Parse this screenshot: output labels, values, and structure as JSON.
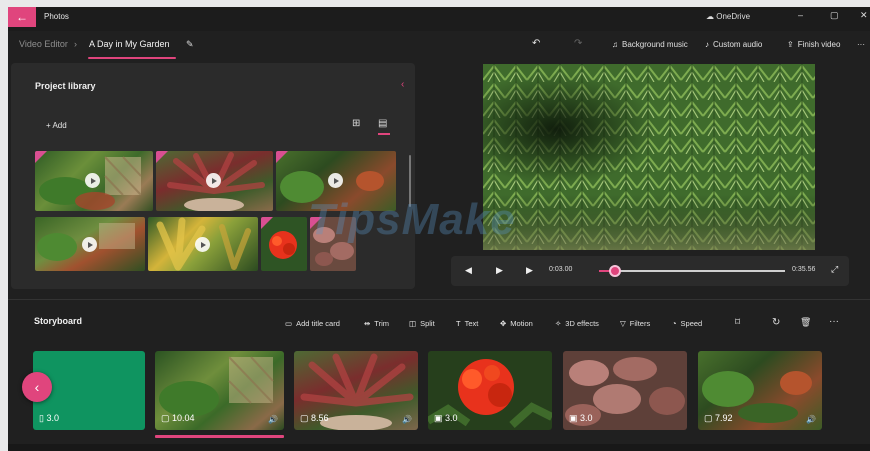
{
  "app": {
    "title": "Photos",
    "onedrive": "OneDrive",
    "back_icon": "arrow-left-icon"
  },
  "window": {
    "minimize": "–",
    "maximize": "▢",
    "close": "✕"
  },
  "nav": {
    "section": "Video Editor",
    "separator": "›",
    "project_title": "A Day in My Garden",
    "edit_icon": "pencil-icon"
  },
  "toolbar": {
    "undo": "↶",
    "redo": "↷",
    "background_music": "Background music",
    "custom_audio": "Custom audio",
    "finish_video": "Finish video",
    "more": "···"
  },
  "library": {
    "title": "Project library",
    "add_label": "+ Add",
    "grid_view_glyph": "⊞",
    "list_view_glyph": "▤",
    "collapse_glyph": "‹",
    "items": [
      {
        "type": "video",
        "palette": "garden"
      },
      {
        "type": "video",
        "palette": "leaves"
      },
      {
        "type": "video",
        "palette": "pots"
      },
      {
        "type": "video",
        "palette": "garden"
      },
      {
        "type": "video",
        "palette": "croton"
      },
      {
        "type": "image",
        "palette": "red-flower"
      },
      {
        "type": "image",
        "palette": "red-leaves"
      }
    ]
  },
  "player": {
    "rewind": "◀",
    "play": "▶",
    "forward": "▶",
    "current_time": "0:03.00",
    "total_time": "0:35.56",
    "expand": "⤢",
    "progress": 0.085
  },
  "storyboard": {
    "title": "Storyboard",
    "tools": {
      "add_title_card": "Add title card",
      "trim": "Trim",
      "split": "Split",
      "text": "Text",
      "motion": "Motion",
      "effects_3d": "3D effects",
      "filters": "Filters",
      "speed": "Speed",
      "crop": "⌑",
      "rotate": "↻",
      "delete": "🗑",
      "more": "···"
    },
    "clips": [
      {
        "label": "3.0",
        "kind": "title-card",
        "color": "#0f9460"
      },
      {
        "label": "10.04",
        "kind": "video",
        "selected": true
      },
      {
        "label": "8.56",
        "kind": "video"
      },
      {
        "label": "3.0",
        "kind": "image"
      },
      {
        "label": "3.0",
        "kind": "image"
      },
      {
        "label": "7.92",
        "kind": "video"
      }
    ],
    "prev_glyph": "‹"
  },
  "watermark": "TipsMake",
  "colors": {
    "accent": "#e0457d",
    "background": "#202020",
    "panel": "#2b2b2b"
  }
}
